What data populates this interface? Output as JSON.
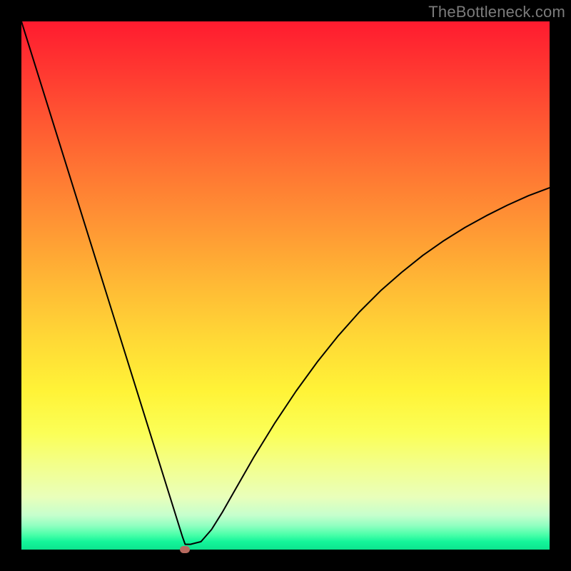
{
  "watermark": {
    "text": "TheBottleneck.com"
  },
  "chart_data": {
    "type": "line",
    "title": "",
    "xlabel": "",
    "ylabel": "",
    "xlim": [
      0,
      100
    ],
    "ylim": [
      0,
      100
    ],
    "grid": false,
    "series": [
      {
        "name": "bottleneck-curve",
        "x": [
          0,
          2,
          4,
          6,
          8,
          10,
          12,
          14,
          16,
          18,
          20,
          22,
          24,
          26,
          28,
          29,
          30,
          30.5,
          31,
          32,
          34,
          36,
          38,
          40,
          44,
          48,
          52,
          56,
          60,
          64,
          68,
          72,
          76,
          80,
          84,
          88,
          92,
          96,
          100
        ],
        "y": [
          100,
          93.6,
          87.2,
          80.8,
          74.4,
          68,
          61.6,
          55.2,
          48.8,
          42.4,
          36,
          29.6,
          23.2,
          16.8,
          10.4,
          7.2,
          4,
          2.4,
          1,
          1,
          1.5,
          3.8,
          7,
          10.5,
          17.5,
          24,
          30,
          35.5,
          40.5,
          45,
          49,
          52.5,
          55.7,
          58.5,
          61,
          63.2,
          65.2,
          67,
          68.5
        ]
      }
    ],
    "marker": {
      "x": 31,
      "y": 0,
      "color": "#b76a5f"
    },
    "background_gradient": {
      "stops": [
        {
          "offset": 0.0,
          "color": "#ff1b2f"
        },
        {
          "offset": 0.1,
          "color": "#ff3a31"
        },
        {
          "offset": 0.2,
          "color": "#ff5b32"
        },
        {
          "offset": 0.3,
          "color": "#ff7b33"
        },
        {
          "offset": 0.4,
          "color": "#ff9a34"
        },
        {
          "offset": 0.5,
          "color": "#ffba35"
        },
        {
          "offset": 0.6,
          "color": "#ffd836"
        },
        {
          "offset": 0.7,
          "color": "#fff337"
        },
        {
          "offset": 0.78,
          "color": "#fbff57"
        },
        {
          "offset": 0.84,
          "color": "#f3ff8b"
        },
        {
          "offset": 0.9,
          "color": "#e9ffba"
        },
        {
          "offset": 0.935,
          "color": "#c6ffcd"
        },
        {
          "offset": 0.955,
          "color": "#8fffc0"
        },
        {
          "offset": 0.972,
          "color": "#4affa9"
        },
        {
          "offset": 0.985,
          "color": "#14f59a"
        },
        {
          "offset": 1.0,
          "color": "#0ce48e"
        }
      ]
    }
  }
}
